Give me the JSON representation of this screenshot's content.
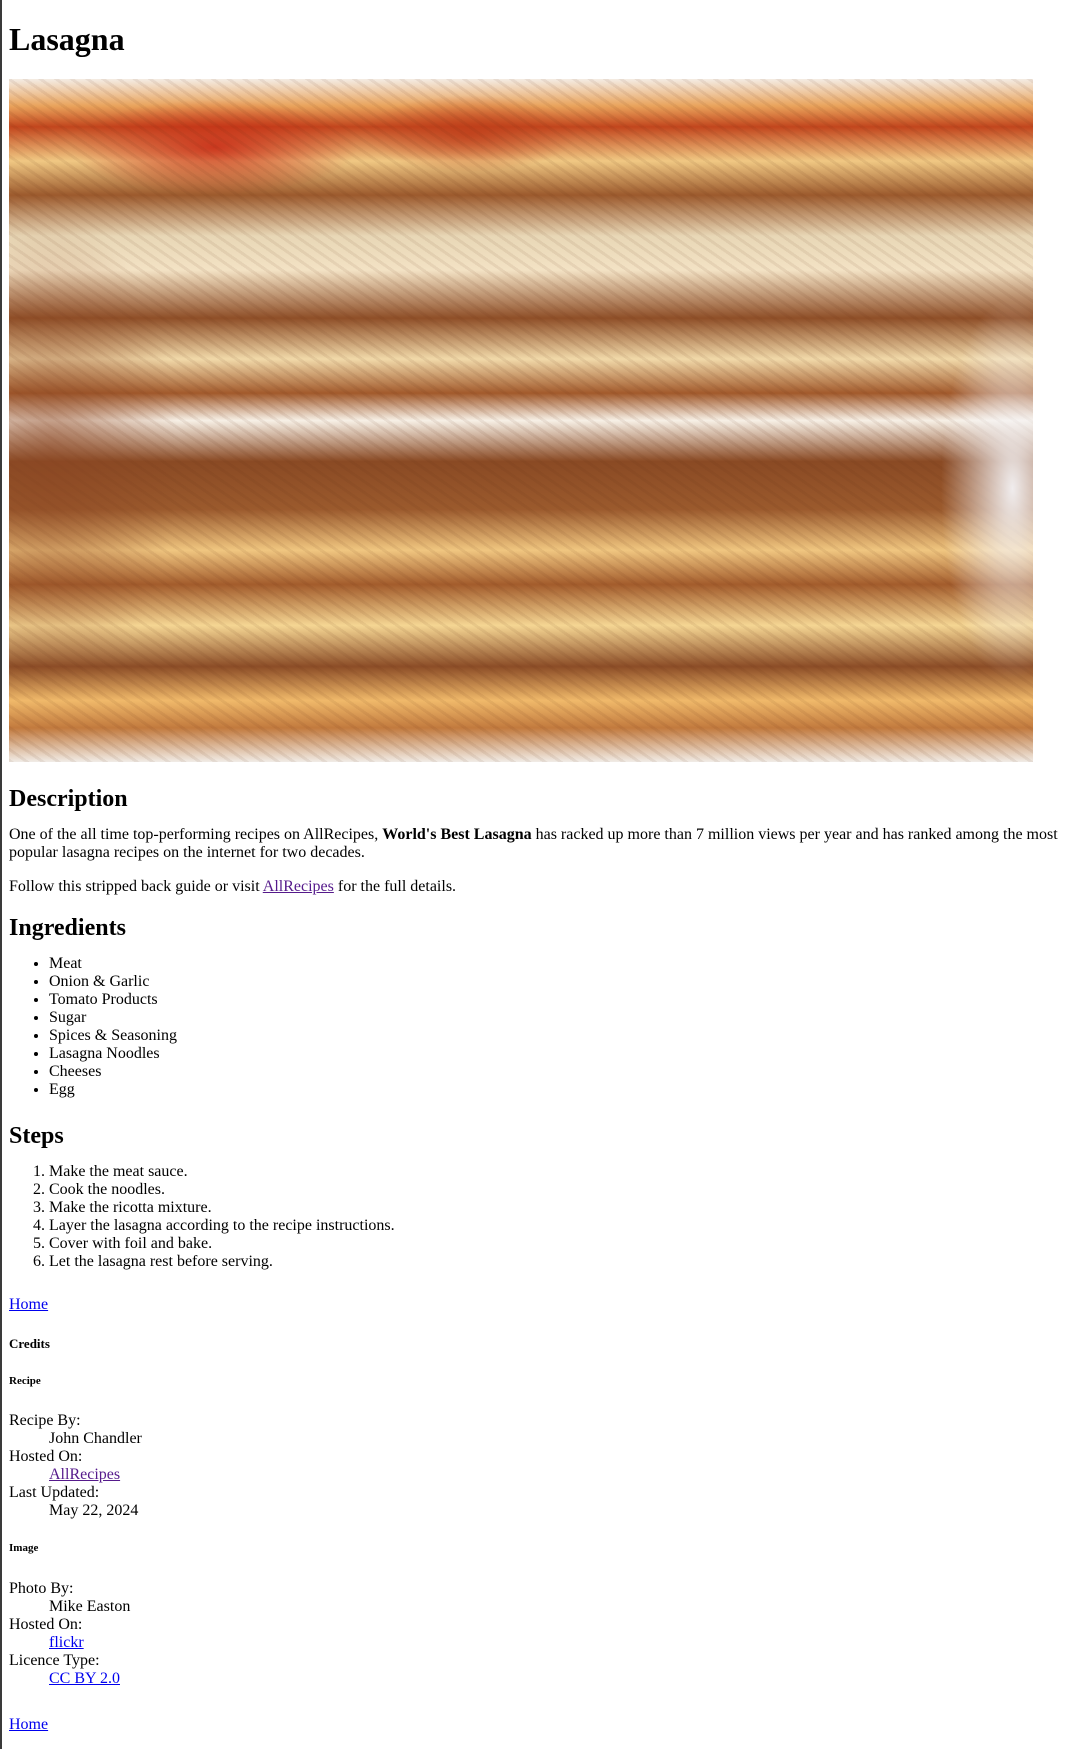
{
  "title": "Lasagna",
  "photo": {
    "alt": "Lasagna"
  },
  "description": {
    "heading": "Description",
    "p1_before": "One of the all time top-performing recipes on AllRecipes, ",
    "p1_bold": "World's Best Lasagna",
    "p1_after": " has racked up more than 7 million views per year and has ranked among the most popular lasagna recipes on the internet for two decades.",
    "p2_before": "Follow this stripped back guide or visit ",
    "p2_link": "AllRecipes",
    "p2_after": " for the full details."
  },
  "ingredients": {
    "heading": "Ingredients",
    "items": [
      "Meat",
      "Onion & Garlic",
      "Tomato Products",
      "Sugar",
      "Spices & Seasoning",
      "Lasagna Noodles",
      "Cheeses",
      "Egg"
    ]
  },
  "steps": {
    "heading": "Steps",
    "items": [
      "Make the meat sauce.",
      "Cook the noodles.",
      "Make the ricotta mixture.",
      "Layer the lasagna according to the recipe instructions.",
      "Cover with foil and bake.",
      "Let the lasagna rest before serving."
    ]
  },
  "nav": {
    "home": "Home"
  },
  "credits": {
    "heading": "Credits",
    "recipe": {
      "heading": "Recipe",
      "recipe_by_label": "Recipe By:",
      "recipe_by": "John Chandler",
      "hosted_on_label": "Hosted On:",
      "hosted_on": "AllRecipes",
      "updated_label": "Last Updated:",
      "updated": "May 22, 2024"
    },
    "image": {
      "heading": "Image",
      "photo_by_label": "Photo By:",
      "photo_by": "Mike Easton",
      "hosted_on_label": "Hosted On:",
      "hosted_on": "flickr",
      "licence_label": "Licence Type:",
      "licence": "CC BY 2.0"
    }
  }
}
